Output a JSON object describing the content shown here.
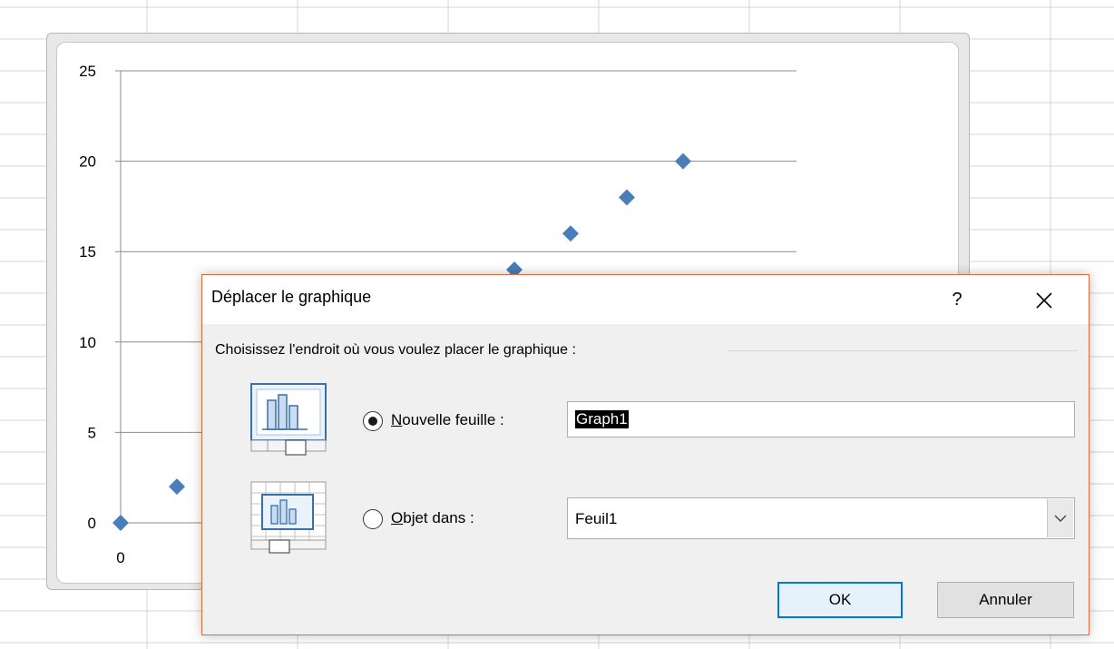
{
  "chart_data": {
    "type": "scatter",
    "y_ticks": [
      "25",
      "20",
      "15",
      "10",
      "5",
      "0"
    ],
    "x_ticks_visible": [
      "0"
    ],
    "ylim": [
      0,
      25
    ],
    "series": [
      {
        "values": [
          [
            0,
            0
          ],
          [
            1,
            2
          ],
          [
            7,
            14
          ],
          [
            8,
            16
          ],
          [
            9,
            18
          ],
          [
            10,
            20
          ]
        ]
      }
    ],
    "marker_color": "#4a7ebb",
    "grid": true
  },
  "dialog": {
    "title": "Déplacer le graphique",
    "help": "?",
    "close": "✕",
    "prompt": "Choisissez l'endroit où vous voulez placer le graphique :",
    "option_new_sheet": {
      "label_mnemonic": "N",
      "label_rest": "ouvelle feuille :",
      "value": "Graph1",
      "selected": true,
      "icon": "new-sheet-chart-icon"
    },
    "option_object_in": {
      "label_mnemonic": "O",
      "label_rest": "bjet dans :",
      "value": "Feuil1",
      "selected": false,
      "icon": "embedded-chart-icon"
    },
    "ok_label": "OK",
    "cancel_label": "Annuler"
  },
  "colors": {
    "accent_border": "#e06b3c",
    "ok_border": "#0078d7"
  }
}
